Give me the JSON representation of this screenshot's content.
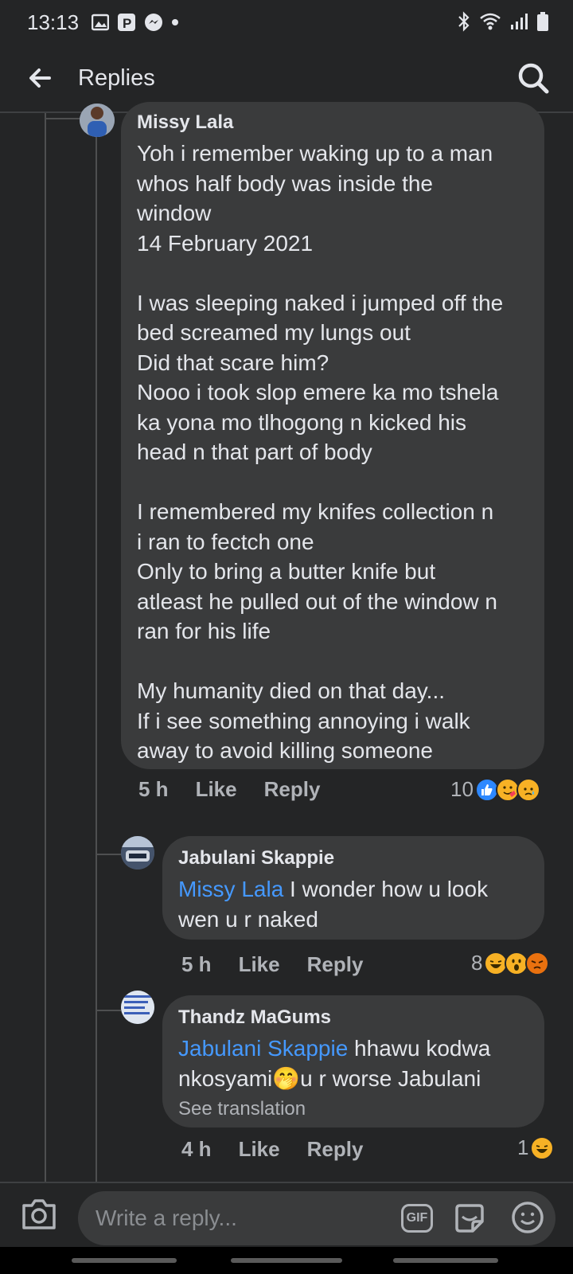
{
  "status_bar": {
    "time": "13:13",
    "icons": [
      "gallery-icon",
      "p-icon",
      "messenger-icon",
      "dot-icon",
      "bluetooth-icon",
      "wifi-icon",
      "signal-icon",
      "battery-icon"
    ]
  },
  "header": {
    "title": "Replies",
    "back_icon": "arrow-left-icon",
    "search_icon": "search-icon"
  },
  "comments": [
    {
      "author": "Missy Lala",
      "text": "Yoh i remember waking up to a man\nwhos half body was inside the\nwindow\n14 February 2021\n\nI was sleeping naked i jumped off the\nbed screamed my lungs out\nDid that scare him?\nNooo i took slop emere ka mo tshela\nka yona mo tlhogong n kicked his\nhead n that part of body\n\nI remembered my knifes collection n\ni ran to fectch one\nOnly to bring a butter knife but\natleast he pulled out of the window n\nran for his life\n\nMy humanity died on that day...\nIf i see something annoying i walk\naway to avoid killing someone",
      "time": "5 h",
      "like_label": "Like",
      "reply_label": "Reply",
      "reaction_count": "10",
      "reactions": [
        "like",
        "love-face",
        "sad"
      ]
    },
    {
      "author": "Jabulani Skappie",
      "mention": "Missy Lala",
      "text": " I wonder how u look\nwen u r naked",
      "time": "5 h",
      "like_label": "Like",
      "reply_label": "Reply",
      "reaction_count": "8",
      "reactions": [
        "haha",
        "wow",
        "angry"
      ]
    },
    {
      "author": "Thandz MaGums",
      "mention": "Jabulani Skappie",
      "text": " hhawu kodwa\nnkosyami🤭u r worse Jabulani",
      "see_translation": "See translation",
      "time": "4 h",
      "like_label": "Like",
      "reply_label": "Reply",
      "reaction_count": "1",
      "reactions": [
        "haha"
      ]
    }
  ],
  "composer": {
    "placeholder": "Write a reply...",
    "gif_label": "GIF"
  },
  "colors": {
    "background": "#242526",
    "bubble": "#3a3b3c",
    "mention": "#4599ff",
    "meta": "#b0b3b8"
  }
}
